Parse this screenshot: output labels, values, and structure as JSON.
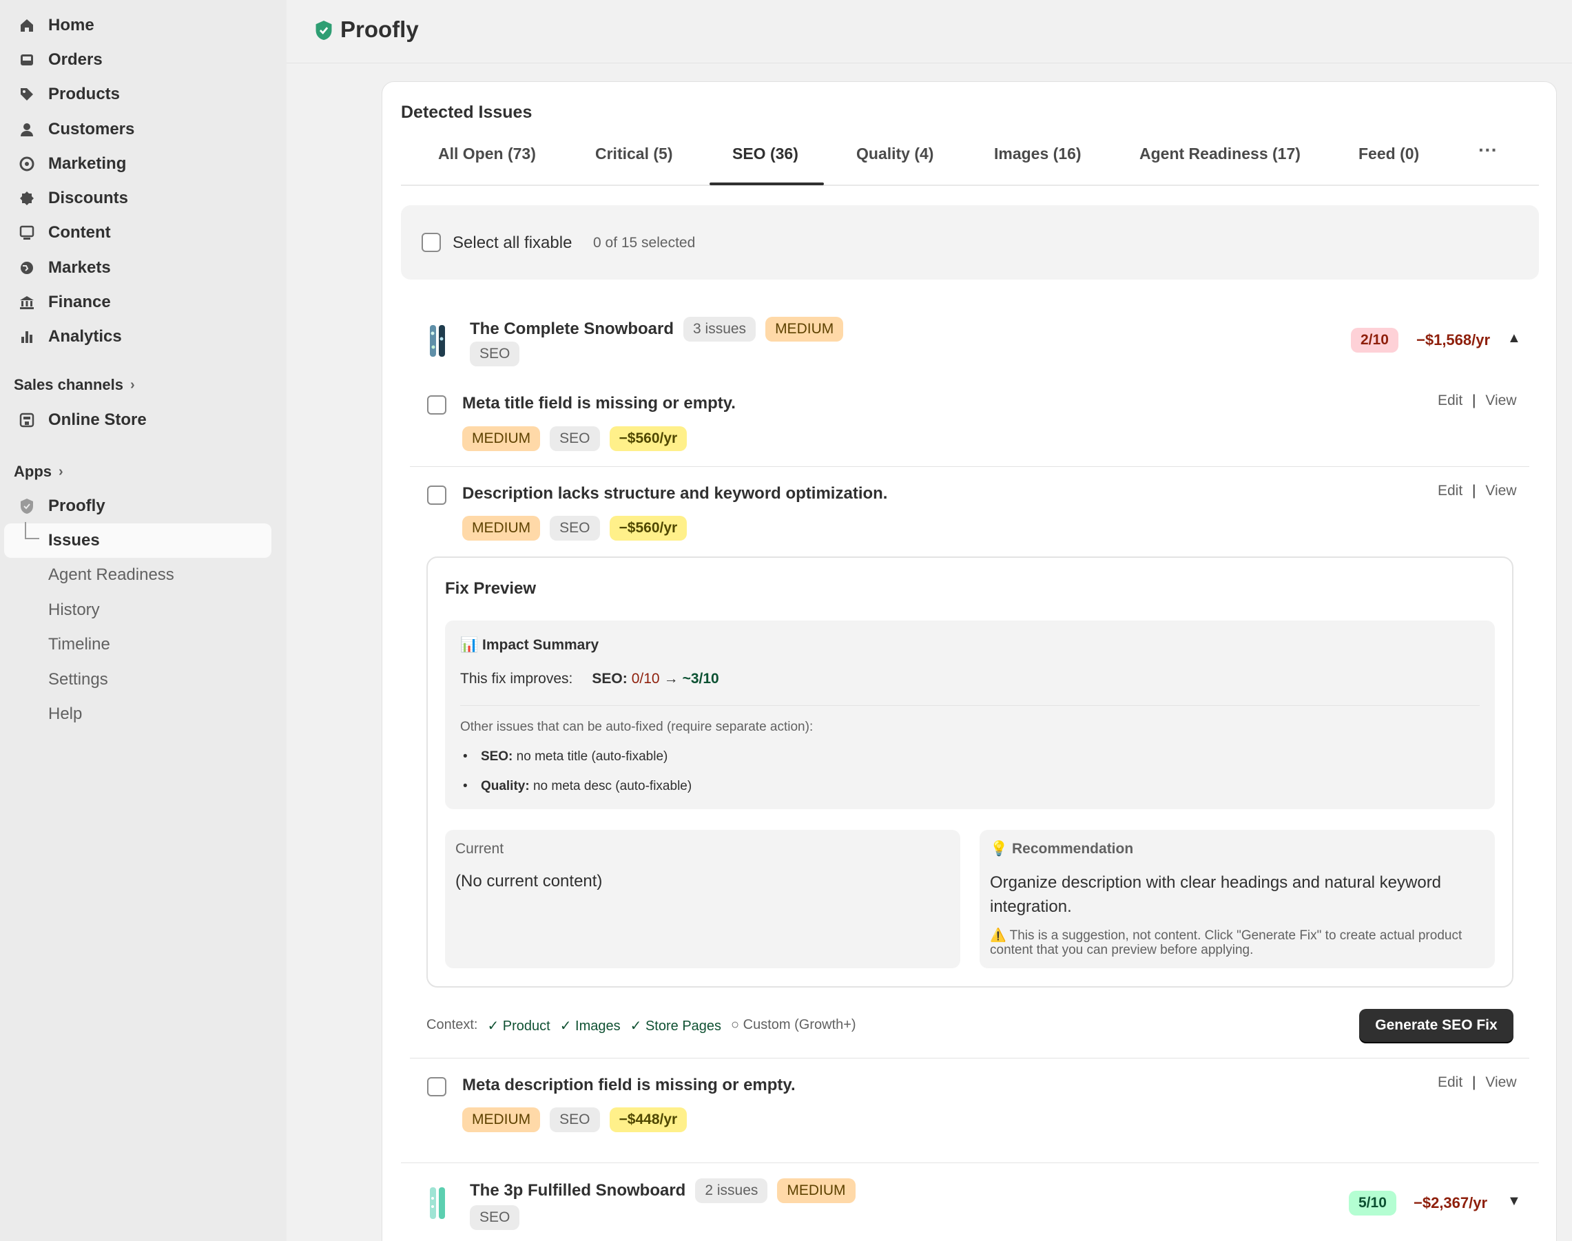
{
  "sidebar": {
    "items": [
      {
        "label": "Home",
        "icon": "home-icon"
      },
      {
        "label": "Orders",
        "icon": "inbox-icon"
      },
      {
        "label": "Products",
        "icon": "tag-icon"
      },
      {
        "label": "Customers",
        "icon": "person-icon"
      },
      {
        "label": "Marketing",
        "icon": "target-icon"
      },
      {
        "label": "Discounts",
        "icon": "discount-icon"
      },
      {
        "label": "Content",
        "icon": "content-icon"
      },
      {
        "label": "Markets",
        "icon": "globe-icon"
      },
      {
        "label": "Finance",
        "icon": "bank-icon"
      },
      {
        "label": "Analytics",
        "icon": "bar-chart-icon"
      }
    ],
    "sales_channels": "Sales channels",
    "online_store": "Online Store",
    "apps": "Apps",
    "proofly": "Proofly",
    "sub_items": [
      "Issues",
      "Agent Readiness",
      "History",
      "Timeline",
      "Settings",
      "Help"
    ]
  },
  "header": {
    "title": "Proofly"
  },
  "card": {
    "title": "Detected Issues",
    "tabs": [
      "All Open (73)",
      "Critical (5)",
      "SEO (36)",
      "Quality (4)",
      "Images (16)",
      "Agent Readiness (17)",
      "Feed (0)"
    ],
    "more": "···",
    "select_all": "Select all fixable",
    "selected": "0 of 15 selected"
  },
  "products": [
    {
      "name": "The Complete Snowboard",
      "issues": "3 issues",
      "severity": "MEDIUM",
      "tag": "SEO",
      "score": "2/10",
      "loss": "−$1,568/yr",
      "caret": "▲"
    },
    {
      "name": "The 3p Fulfilled Snowboard",
      "issues": "2 issues",
      "severity": "MEDIUM",
      "tag": "SEO",
      "score": "5/10",
      "loss": "−$2,367/yr",
      "caret": "▼"
    }
  ],
  "issues": [
    {
      "title": "Meta title field is missing or empty.",
      "severity": "MEDIUM",
      "tag": "SEO",
      "impact": "−$560/yr"
    },
    {
      "title": "Description lacks structure and keyword optimization.",
      "severity": "MEDIUM",
      "tag": "SEO",
      "impact": "−$560/yr"
    },
    {
      "title": "Meta description field is missing or empty.",
      "severity": "MEDIUM",
      "tag": "SEO",
      "impact": "−$448/yr"
    }
  ],
  "actions": {
    "edit": "Edit",
    "sep": "|",
    "view": "View"
  },
  "fix_preview": {
    "title": "Fix Preview",
    "impact_title": "📊 Impact Summary",
    "improves_label": "This fix improves:",
    "seo_label": "SEO:",
    "seo_from": "0/10",
    "arrow": "→",
    "seo_to": "~3/10",
    "other_label": "Other issues that can be auto-fixed (require separate action):",
    "other": [
      {
        "cat": "SEO:",
        "text": "no meta title (auto-fixable)"
      },
      {
        "cat": "Quality:",
        "text": "no meta desc (auto-fixable)"
      }
    ],
    "current_label": "Current",
    "current_value": "(No current content)",
    "rec_label": "💡 Recommendation",
    "rec_value": "Organize description with clear headings and natural keyword integration.",
    "warning": "⚠️ This is a suggestion, not content. Click \"Generate Fix\" to create actual product content that you can preview before applying."
  },
  "context": {
    "label": "Context:",
    "items": [
      "✓ Product",
      "✓ Images",
      "✓ Store Pages"
    ],
    "custom": "○ Custom (Growth+)",
    "button": "Generate SEO Fix"
  },
  "colors": {
    "accent_red": "#8e1f0b",
    "accent_green": "#0c5132",
    "medium_bg": "#ffd9a8",
    "impact_bg": "#fff08a"
  }
}
